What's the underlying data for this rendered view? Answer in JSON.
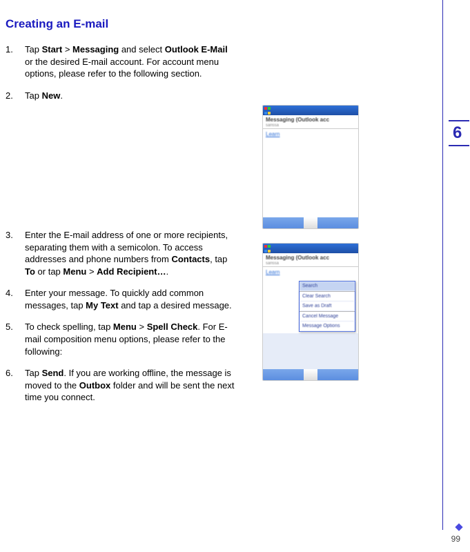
{
  "heading": "Creating an E-mail",
  "steps": [
    {
      "num": "1.",
      "html": "Tap <b>Start</b> > <b>Messaging</b> and select <b>Outlook E-Mail</b> or the desired E-mail account. For account menu options, please refer to the following section."
    },
    {
      "num": "2.",
      "html": "Tap <b>New</b>."
    },
    {
      "num": "3.",
      "html": "Enter the E-mail address of one or more recipients, separating them with a semicolon. To access addresses and phone numbers from <b>Contacts</b>, tap <b>To</b> or tap <b>Menu</b> > <b>Add Recipient…</b>."
    },
    {
      "num": "4.",
      "html": "Enter your message. To quickly add common messages, tap <b>My Text</b> and tap a desired message."
    },
    {
      "num": "5.",
      "html": "To check spelling, tap <b>Menu</b> > <b>Spell Check</b>. For E-mail composition menu options, please refer to the following:"
    },
    {
      "num": "6.",
      "html": "Tap <b>Send</b>. If you are working offline, the message is moved to the <b>Outbox</b> folder and will be sent the next time you connect."
    }
  ],
  "chapter": "6",
  "page_number": "99",
  "shot1": {
    "title_main": "Messaging (Outlook acc",
    "title_sub": "sarissa",
    "link": "Learn"
  },
  "shot2": {
    "title_main": "Messaging (Outlook acc",
    "title_sub": "sarissa",
    "link": "Learn",
    "menu": [
      "Search",
      "Clear Search",
      "Save as Draft",
      "Cancel Message",
      "Message Options"
    ]
  }
}
